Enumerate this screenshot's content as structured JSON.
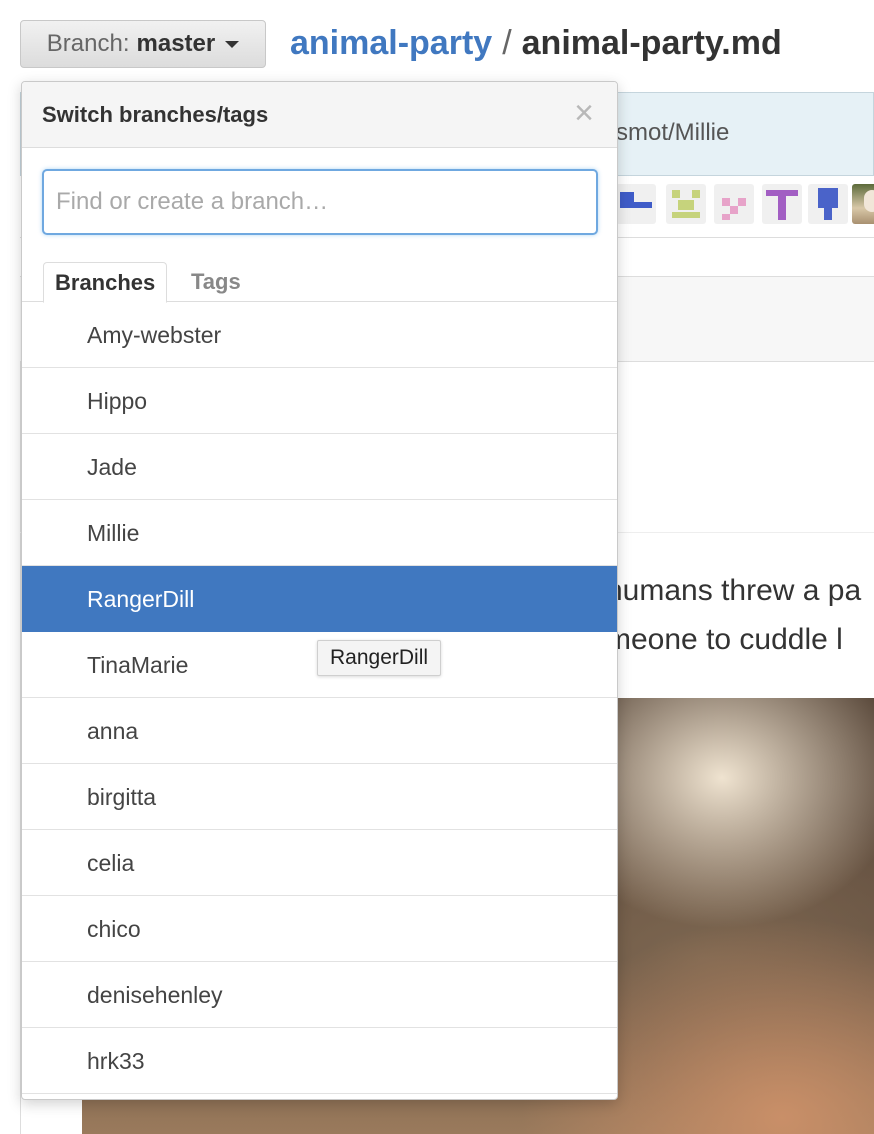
{
  "header": {
    "branch_label": "Branch:",
    "branch_value": "master",
    "repo": "animal-party",
    "separator": "/",
    "file": "animal-party.md"
  },
  "background": {
    "commit_fragment": "smot/Millie",
    "article_line1": "humans threw a pa",
    "article_line2": "meone to cuddle l"
  },
  "dropdown": {
    "title": "Switch branches/tags",
    "close_glyph": "×",
    "filter_placeholder": "Find or create a branch…",
    "filter_value": "",
    "tabs": [
      {
        "label": "Branches",
        "selected": true
      },
      {
        "label": "Tags",
        "selected": false
      }
    ],
    "branches": [
      {
        "label": "Amy-webster"
      },
      {
        "label": "Hippo"
      },
      {
        "label": "Jade"
      },
      {
        "label": "Millie"
      },
      {
        "label": "RangerDill",
        "active": true
      },
      {
        "label": "TinaMarie"
      },
      {
        "label": "anna"
      },
      {
        "label": "birgitta"
      },
      {
        "label": "celia"
      },
      {
        "label": "chico"
      },
      {
        "label": "denisehenley"
      },
      {
        "label": "hrk33"
      }
    ]
  },
  "tooltip": {
    "text": "RangerDill"
  },
  "colors": {
    "accent": "#4078c0",
    "commit_bar": "#e6f1f6",
    "focus_ring": "#6fa8e0"
  }
}
